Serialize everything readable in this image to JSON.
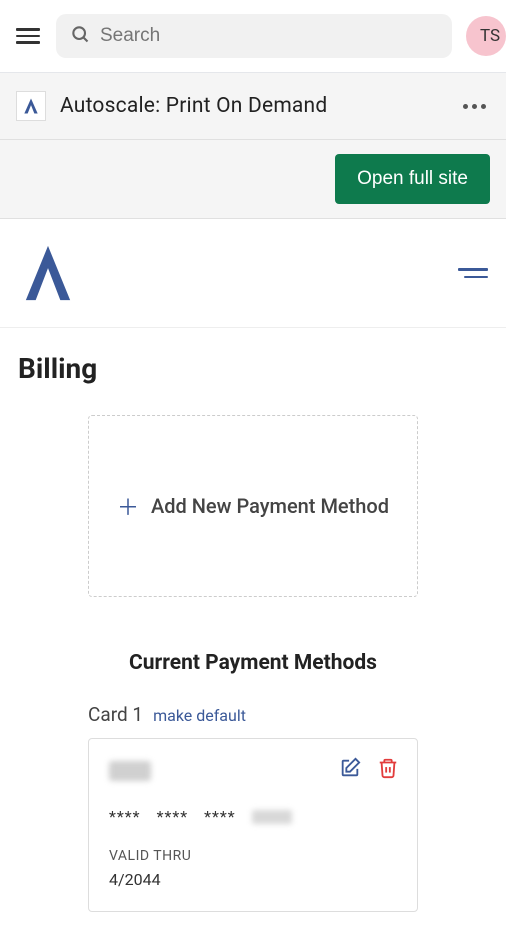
{
  "search": {
    "placeholder": "Search"
  },
  "avatar": {
    "initials": "TS"
  },
  "appTab": {
    "title": "Autoscale: Print On Demand"
  },
  "banner": {
    "openSite": "Open full site"
  },
  "page": {
    "title": "Billing"
  },
  "addPayment": {
    "label": "Add New Payment Method"
  },
  "section": {
    "currentMethods": "Current Payment Methods"
  },
  "card": {
    "label": "Card 1",
    "makeDefault": "make default",
    "maskedGroups": [
      "****",
      "****",
      "****"
    ],
    "validThruLabel": "VALID THRU",
    "expiry": "4/2044"
  },
  "colors": {
    "accent": "#3b5998",
    "green": "#0e7a4d",
    "avatarBg": "#f7c4ce"
  }
}
